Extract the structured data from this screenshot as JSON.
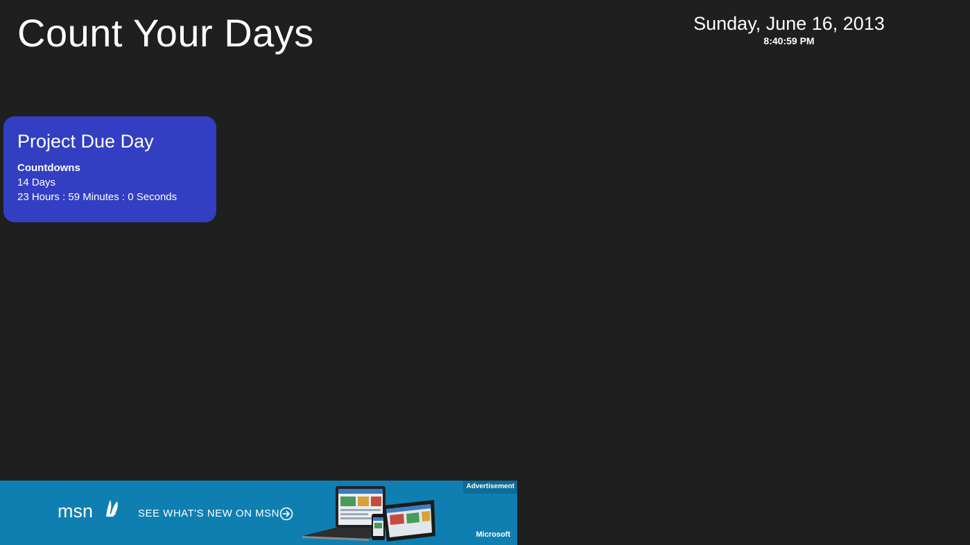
{
  "app": {
    "title": "Count Your Days"
  },
  "clock": {
    "date": "Sunday, June 16, 2013",
    "time": "8:40:59 PM"
  },
  "tiles": [
    {
      "title": "Project Due Day",
      "heading": "Countdowns",
      "days": "14 Days",
      "remaining": "23 Hours : 59 Minutes : 0 Seconds",
      "color": "#333fc2"
    }
  ],
  "ad": {
    "logo_text": "msn",
    "tagline": "SEE WHAT'S NEW ON MSN.",
    "badge": "Advertisement",
    "brand": "Microsoft",
    "background_color": "#0f7fb2",
    "arrow_icon": "circle-arrow-right-icon",
    "logo_icon": "msn-butterfly-icon"
  },
  "colors": {
    "background": "#1f1f1f",
    "text": "#ffffff"
  }
}
